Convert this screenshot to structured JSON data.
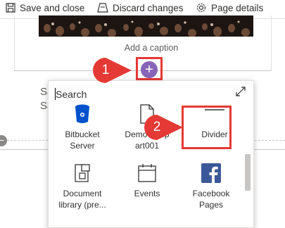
{
  "toolbar": {
    "save_label": "Save and close",
    "discard_label": "Discard changes",
    "details_label": "Page details"
  },
  "canvas": {
    "caption": "Add a caption",
    "behind_text_1": "Sa",
    "behind_text_2": "Sa"
  },
  "toolbox": {
    "search_placeholder": "Search",
    "items": [
      {
        "label": "Bitbucket Server",
        "icon": "bitbucket-icon"
      },
      {
        "label": "DemoWebp art001",
        "icon": "document-icon"
      },
      {
        "label": "Divider",
        "icon": "divider-icon"
      },
      {
        "label": "Document library (pre...",
        "icon": "document-library-icon"
      },
      {
        "label": "Events",
        "icon": "calendar-icon"
      },
      {
        "label": "Facebook Pages",
        "icon": "facebook-icon"
      }
    ]
  },
  "annotations": {
    "step1": "1",
    "step2": "2"
  },
  "colors": {
    "accent_purple": "#8764b8",
    "annotation_red": "#e53935",
    "bitbucket_blue": "#0052cc",
    "facebook_blue": "#3b5998"
  }
}
